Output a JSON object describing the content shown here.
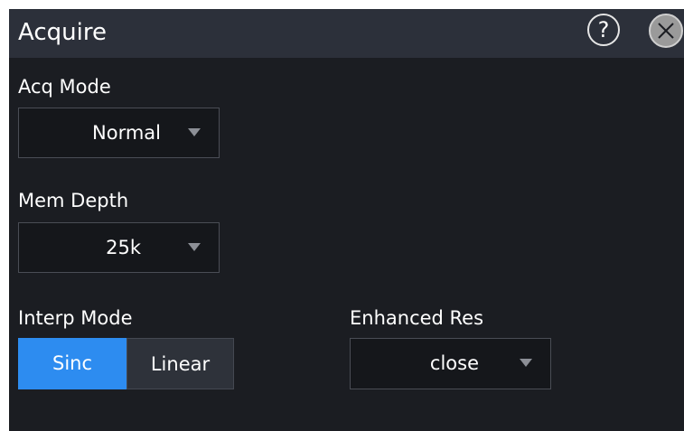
{
  "window": {
    "title": "Acquire",
    "help_label": "?"
  },
  "acq_mode": {
    "label": "Acq Mode",
    "value": "Normal"
  },
  "mem_depth": {
    "label": "Mem Depth",
    "value": "25k"
  },
  "interp_mode": {
    "label": "Interp Mode",
    "options": [
      "Sinc",
      "Linear"
    ],
    "selected": "Sinc"
  },
  "enhanced_res": {
    "label": "Enhanced Res",
    "value": "close"
  },
  "colors": {
    "panel_bg": "#1b1d22",
    "titlebar_bg": "#2c303a",
    "accent": "#2d8cf0",
    "text": "#ffffff"
  },
  "icons": {
    "help": "help-circle-icon",
    "close": "close-circle-icon",
    "dropdown": "caret-down-icon"
  }
}
